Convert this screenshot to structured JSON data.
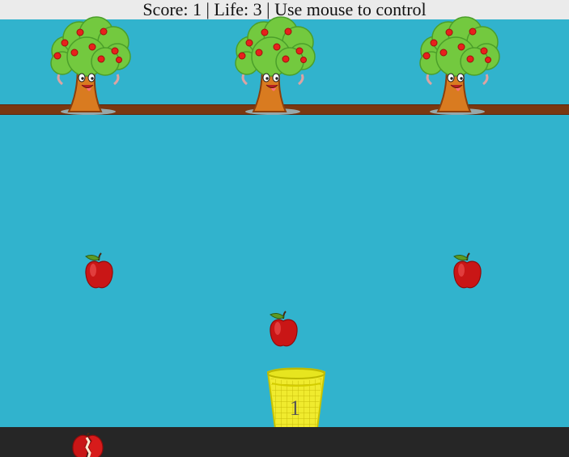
{
  "hud": {
    "text": "Score: 1 | Life: 3 | Use mouse to control",
    "score": 1,
    "life": 3
  },
  "trees": [
    {
      "icon": "apple-tree-icon"
    },
    {
      "icon": "apple-tree-icon"
    },
    {
      "icon": "apple-tree-icon"
    }
  ],
  "falling_apples": [
    {
      "icon": "red-apple-icon"
    },
    {
      "icon": "red-apple-icon"
    },
    {
      "icon": "red-apple-icon"
    }
  ],
  "basket": {
    "icon": "basket-icon",
    "count": "1"
  },
  "broken_apple": {
    "icon": "broken-apple-icon"
  },
  "colors": {
    "sky": "#31b3cd",
    "topbar": "#ebebeb",
    "branch": "#7a3710",
    "ground": "#262626",
    "apple": "#c91616",
    "basket": "#f0eb2e"
  }
}
